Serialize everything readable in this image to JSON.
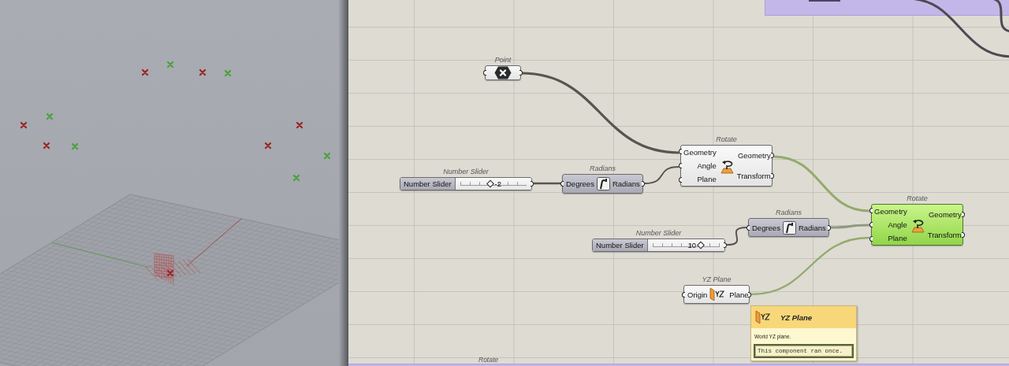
{
  "canvas": {
    "nodes": [
      {
        "kind": "param",
        "label": "Point",
        "preview": true,
        "selected": false
      },
      {
        "kind": "component",
        "label": "Rotate",
        "inputs": [
          "Geometry",
          "Angle",
          "Plane"
        ],
        "outputs": [
          "Geometry",
          "Transform"
        ],
        "preview": true,
        "selected": false
      },
      {
        "kind": "slider",
        "label": "Number Slider",
        "name": "Number Slider",
        "value": "-2",
        "level": 0.46
      },
      {
        "kind": "component",
        "label": "Radians",
        "inputs": [
          "Degrees"
        ],
        "outputs": [
          "Radians"
        ],
        "preview": false,
        "selected": false
      },
      {
        "kind": "component",
        "label": "Radians",
        "inputs": [
          "Degrees"
        ],
        "outputs": [
          "Radians"
        ],
        "preview": false,
        "selected": false
      },
      {
        "kind": "component",
        "label": "Rotate",
        "inputs": [
          "Geometry",
          "Angle",
          "Plane"
        ],
        "outputs": [
          "Geometry",
          "Transform"
        ],
        "preview": true,
        "selected": true
      },
      {
        "kind": "slider",
        "label": "Number Slider",
        "name": "Number Slider",
        "value": "10",
        "level": 0.72
      },
      {
        "kind": "component",
        "label": "YZ Plane",
        "inputs": [
          "Origin"
        ],
        "outputs": [
          "Plane"
        ],
        "preview": true,
        "selected": false
      }
    ],
    "tooltip": {
      "title": "YZ Plane",
      "description": "World YZ plane.",
      "status": "This component ran once."
    },
    "bottom_group_label": "Rotate"
  }
}
